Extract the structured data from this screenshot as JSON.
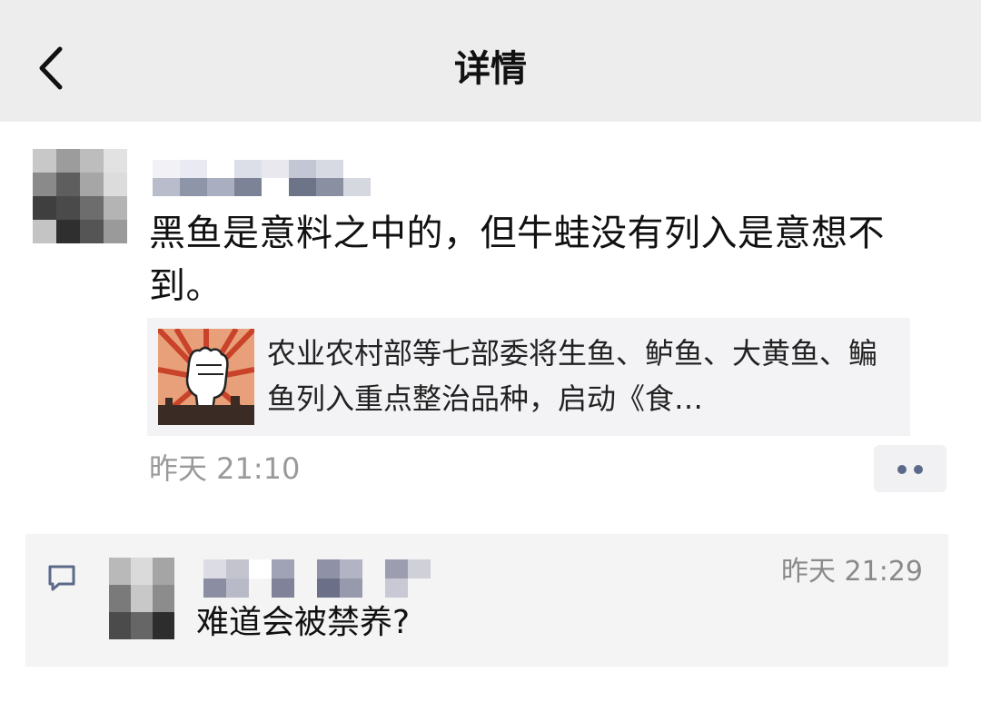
{
  "header": {
    "title": "详情",
    "back_icon": "chevron-left-icon"
  },
  "post": {
    "author_name": "",
    "text": "黑鱼是意料之中的，但牛蛙没有列入是意想不到。",
    "link_card": {
      "title": "农业农村部等七部委将生鱼、鲈鱼、大黄鱼、鳊鱼列入重点整治品种，启动《食…",
      "thumbnail_icon": "raised-fist-icon"
    },
    "time": "昨天 21:10",
    "more_icon": "more-dots-icon"
  },
  "comments": [
    {
      "author_name": "",
      "time": "昨天 21:29",
      "text": "难道会被禁养?",
      "icon": "comment-icon"
    }
  ],
  "colors": {
    "header_bg": "#ededed",
    "text_primary": "#111111",
    "text_secondary": "#9a9a9a",
    "link_card_bg": "#f3f3f5",
    "comment_bg": "#f4f4f4",
    "more_dot": "#5b6a8a"
  }
}
